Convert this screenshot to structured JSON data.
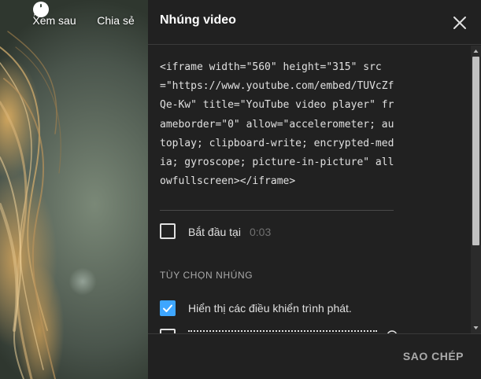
{
  "player": {
    "watch_later_label": "Xem sau",
    "share_label": "Chia sẻ",
    "watch_later_icon": "clock-icon",
    "share_icon": "share-arrow-icon"
  },
  "dialog": {
    "title": "Nhúng video",
    "close_icon": "close-icon",
    "embed_code": "<iframe width=\"560\" height=\"315\" src=\"https://www.youtube.com/embed/TUVcZfQe-Kw\" title=\"YouTube video player\" frameborder=\"0\" allow=\"accelerometer; autoplay; clipboard-write; encrypted-media; gyroscope; picture-in-picture\" allowfullscreen></iframe>",
    "start_at": {
      "label": "Bắt đầu tại",
      "time": "0:03",
      "checked": false
    },
    "embed_options_title": "TÙY CHỌN NHÚNG",
    "show_controls": {
      "label": "Hiển thị các điều khiển trình phát.",
      "checked": true
    },
    "copy_label": "SAO CHÉP"
  },
  "colors": {
    "panel_bg": "#212121",
    "accent_blue": "#3ea6ff",
    "text_primary": "#ffffff",
    "text_muted": "#aaaaaa"
  }
}
